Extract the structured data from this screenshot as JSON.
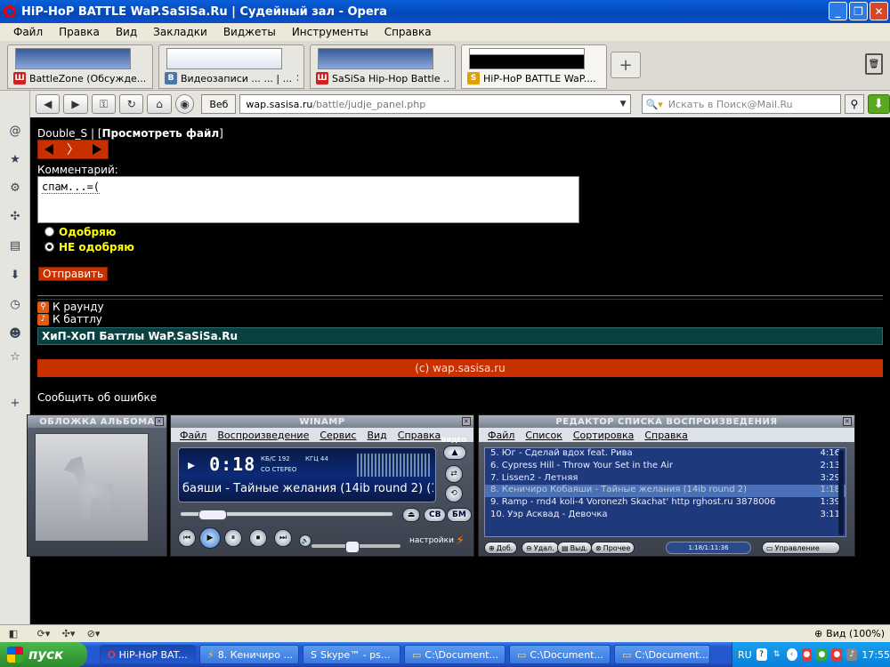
{
  "window": {
    "title": "HiP-HoP BATTLE WaP.SaSiSa.Ru | Судейный зал - Opera"
  },
  "menu": [
    "Файл",
    "Правка",
    "Вид",
    "Закладки",
    "Виджеты",
    "Инструменты",
    "Справка"
  ],
  "tabs": [
    {
      "label": "BattleZone (Обсужде...",
      "fav": "Ш",
      "color": "#d02020"
    },
    {
      "label": "Видеозаписи ... ... | ...",
      "fav": "B",
      "color": "#4a76a8"
    },
    {
      "label": "SaSiSa Hip-Hop Battle ...",
      "fav": "Ш",
      "color": "#d02020"
    },
    {
      "label": "HiP-HoP BATTLE WaP....",
      "fav": "S",
      "color": "#e0a000"
    }
  ],
  "nav": {
    "web_label": "Веб",
    "url_domain": "wap.sasisa.ru",
    "url_path": "/battle/judje_panel.php",
    "search_placeholder": "Искать в Поиск@Mail.Ru"
  },
  "page": {
    "user": "Double_S",
    "view_file": "Просмотреть файл",
    "comment_label": "Комментарий:",
    "comment_value": "спам...=(",
    "approve": "Одобряю",
    "disapprove": "НЕ одобряю",
    "selected": "disapprove",
    "send": "Отправить",
    "to_round": "К раунду",
    "to_battle": "К баттлу",
    "site_title": "ХиП-ХоП Баттлы WaP.SaSiSa.Ru",
    "copyright": "(c) wap.sasisa.ru",
    "report": "Сообщить об ошибке"
  },
  "winamp": {
    "album_title": "ОБЛОЖКА АЛЬБОМА",
    "main_title": "WINAMP",
    "menu": [
      "Файл",
      "Воспроизведение",
      "Сервис",
      "Вид",
      "Справка"
    ],
    "time": "0:18",
    "kbps": "192",
    "khz": "44",
    "stereo": "СО СТЕРЕО",
    "video": "ВИДЕО",
    "song_display": "баяши - Тайные желания (14ib round 2) (1:1",
    "settings": "настройки",
    "pl_title": "РЕДАКТОР СПИСКА ВОСПРОИЗВЕДЕНИЯ",
    "pl_menu": [
      "Файл",
      "Список",
      "Сортировка",
      "Справка"
    ],
    "playlist": [
      {
        "title": "5. Юг - Сделай вдох feat. Рива",
        "dur": "4:16"
      },
      {
        "title": "6. Cypress Hill - Throw Your Set in the Air",
        "dur": "2:13"
      },
      {
        "title": "7. Lissen2 - Летняя",
        "dur": "3:29"
      },
      {
        "title": "8. Кеничиро Кобаяши - Тайные желания (14ib round 2)",
        "dur": "1:18"
      },
      {
        "title": "9. Ramp - rnd4 koli-4 Voronezh Skachat'   http   rghost.ru 3878006",
        "dur": "1:39"
      },
      {
        "title": "10. Уэр Асквад - Девочка",
        "dur": "3:11"
      }
    ],
    "selected_index": 3,
    "pl_add": "Доб.",
    "pl_del": "Удал.",
    "pl_sel": "Выд.",
    "pl_misc": "Прочее",
    "pl_time": "1:18/1:11:36",
    "pl_manage": "Управление"
  },
  "status": {
    "zoom": "Вид (100%)"
  },
  "taskbar": {
    "start": "пуск",
    "items": [
      "HiP-HoP BAT...",
      "8. Кеничиро ...",
      "Skype™ - ps...",
      "C:\\Document...",
      "C:\\Document...",
      "C:\\Document..."
    ],
    "lang": "RU",
    "clock": "17:55"
  },
  "colors": {
    "accent_red": "#c83000",
    "teal": "#0b4040",
    "link_yellow": "#ffff00"
  }
}
